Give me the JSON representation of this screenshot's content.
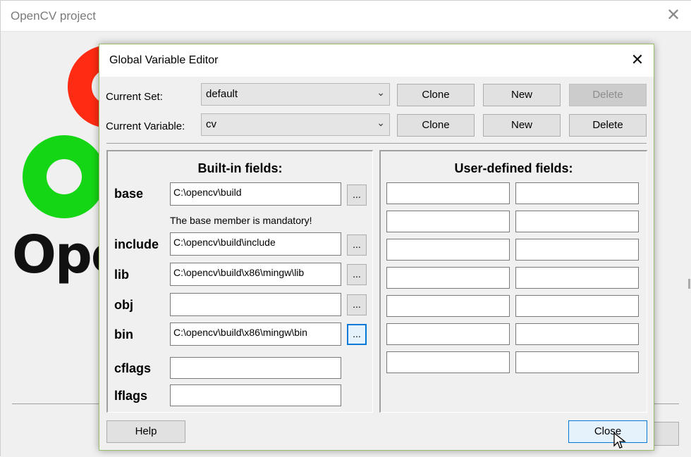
{
  "background_window": {
    "title": "OpenCV project",
    "logo_text": "Ope",
    "logo_colors": {
      "red": "#ff2b12",
      "green": "#14d615"
    }
  },
  "dialog": {
    "title": "Global Variable Editor",
    "current_set": {
      "label": "Current Set:",
      "value": "default",
      "buttons": {
        "clone": "Clone",
        "new": "New",
        "delete": "Delete"
      }
    },
    "current_variable": {
      "label": "Current Variable:",
      "value": "cv",
      "buttons": {
        "clone": "Clone",
        "new": "New",
        "delete": "Delete"
      }
    },
    "builtin": {
      "title": "Built-in fields:",
      "base_note": "The base member is mandatory!",
      "browse_label": "...",
      "fields": {
        "base": {
          "label": "base",
          "value": "C:\\opencv\\build"
        },
        "include": {
          "label": "include",
          "value": "C:\\opencv\\build\\include"
        },
        "lib": {
          "label": "lib",
          "value": "C:\\opencv\\build\\x86\\mingw\\lib"
        },
        "obj": {
          "label": "obj",
          "value": ""
        },
        "bin": {
          "label": "bin",
          "value": "C:\\opencv\\build\\x86\\mingw\\bin"
        },
        "cflags": {
          "label": "cflags",
          "value": ""
        },
        "lflags": {
          "label": "lflags",
          "value": ""
        }
      }
    },
    "user_defined": {
      "title": "User-defined fields:",
      "rows": [
        {
          "name": "",
          "value": ""
        },
        {
          "name": "",
          "value": ""
        },
        {
          "name": "",
          "value": ""
        },
        {
          "name": "",
          "value": ""
        },
        {
          "name": "",
          "value": ""
        },
        {
          "name": "",
          "value": ""
        },
        {
          "name": "",
          "value": ""
        }
      ]
    },
    "footer": {
      "help": "Help",
      "close": "Close"
    }
  }
}
